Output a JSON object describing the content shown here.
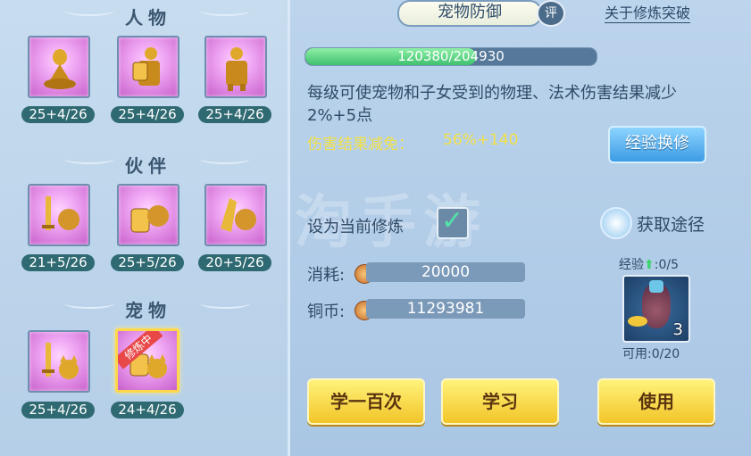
{
  "left": {
    "sections": [
      {
        "title": "人物",
        "items": [
          "25+4/26",
          "25+4/26",
          "25+4/26"
        ]
      },
      {
        "title": "伙伴",
        "items": [
          "21+5/26",
          "25+5/26",
          "20+5/26"
        ]
      },
      {
        "title": "宠物",
        "items": [
          "25+4/26",
          "24+4/26"
        ]
      }
    ],
    "selected_badge": "修炼中"
  },
  "header": {
    "tab_title": "宠物防御",
    "rating_label": "评",
    "about_link": "关于修炼突破"
  },
  "progress": {
    "text": "120380/204930",
    "fraction": 0.587
  },
  "description": "每级可使宠物和子女受到的物理、法术伤害结果减少2%+5点",
  "effect": {
    "label": "伤害结果减免：",
    "value": "56%+140"
  },
  "exp_exchange_button": "经验换修",
  "set_current": {
    "label": "设为当前修炼",
    "checked": true
  },
  "obtain": {
    "label": "获取途径"
  },
  "cost": {
    "label": "消耗:",
    "value": "20000"
  },
  "coins": {
    "label": "铜币:",
    "value": "11293981"
  },
  "exp_item": {
    "label": "经验",
    "progress": ":0/5",
    "count": "3",
    "available": "可用:0/20"
  },
  "buttons": {
    "learn_hundred": "学一百次",
    "learn": "学习",
    "use": "使用"
  },
  "watermark": "淘手游"
}
